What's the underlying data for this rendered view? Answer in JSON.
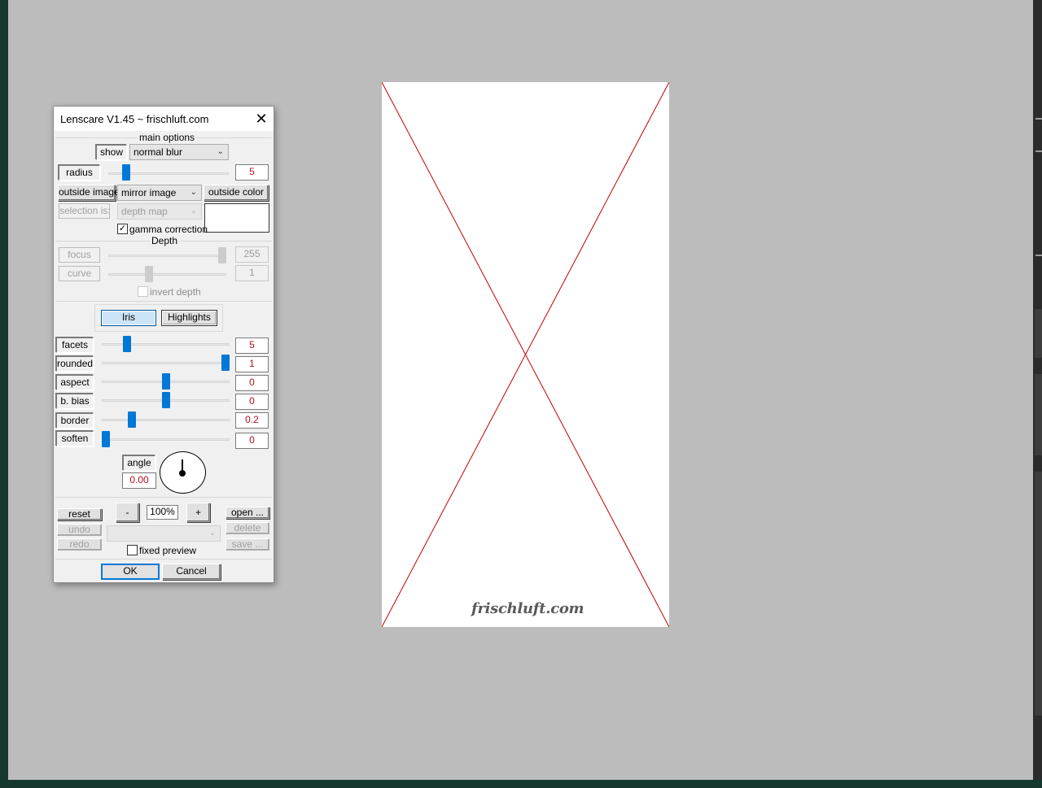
{
  "dialog": {
    "title": "Lenscare V1.45 ~ frischluft.com",
    "close_glyph": "✕",
    "main_options": {
      "section_title": "main options",
      "show_label": "show",
      "show_select": "normal blur",
      "radius_label": "radius",
      "radius_value": "5",
      "radius_level": 0.12,
      "outside_image_label": "outside image",
      "outside_image_select": "mirror image",
      "outside_color_label": "outside color",
      "outside_color_swatch": "#ffffff",
      "selection_label": "selection is:",
      "selection_select": "depth map",
      "gamma_label": "gamma correction",
      "gamma_checked": "✓"
    },
    "depth": {
      "section_title": "Depth",
      "focus_label": "focus",
      "focus_value": "255",
      "focus_level": 1.0,
      "curve_label": "curve",
      "curve_value": "1",
      "curve_level": 0.33,
      "invert_label": "invert depth"
    },
    "tabs": {
      "iris": "Iris",
      "highlights": "Highlights",
      "active": "Iris"
    },
    "iris": {
      "facets_label": "facets",
      "facets_value": "5",
      "facets_level": 0.18,
      "rounded_label": "rounded",
      "rounded_value": "1",
      "rounded_level": 1.0,
      "aspect_label": "aspect",
      "aspect_value": "0",
      "aspect_level": 0.5,
      "bias_label": "b. bias",
      "bias_value": "0",
      "bias_level": 0.5,
      "border_label": "border",
      "border_value": "0.2",
      "border_level": 0.22,
      "soften_label": "soften",
      "soften_value": "0",
      "soften_level": 0.0,
      "angle_label": "angle",
      "angle_value": "0.00"
    },
    "presets": {
      "reset": "reset",
      "undo": "undo",
      "redo": "redo",
      "minus": "-",
      "zoom": "100%",
      "plus": "+",
      "open": "open ...",
      "delete": "delete",
      "save": "save ...",
      "fixed_preview_label": "fixed preview"
    },
    "ok": "OK",
    "cancel": "Cancel"
  },
  "preview": {
    "logo_text": "frischluft.com",
    "line_color": "#c00000"
  }
}
